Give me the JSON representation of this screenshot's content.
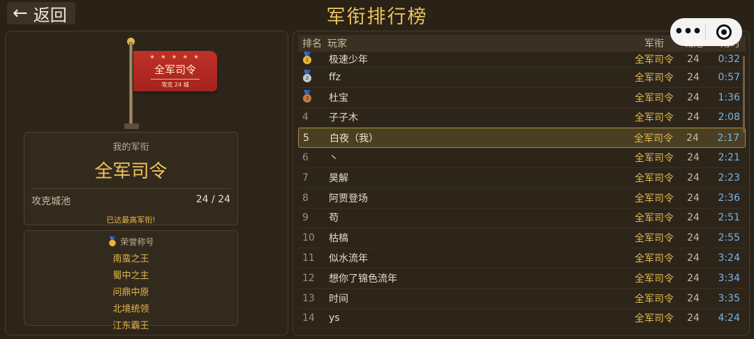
{
  "header": {
    "back_label": "返回",
    "title": "军衔排行榜"
  },
  "flag": {
    "stars": "★ ★ ★ ★ ★",
    "rank": "全军司令",
    "sub": "攻克 24 城"
  },
  "my_rank": {
    "label": "我的军衔",
    "rank": "全军司令",
    "cities_label": "攻克城池",
    "cities_value": "24 / 24",
    "note": "已达最高军衔!"
  },
  "honors": {
    "title": "荣誉称号",
    "items": [
      "南蛮之王",
      "蜀中之主",
      "问鼎中原",
      "北境统领",
      "江东霸王"
    ]
  },
  "table": {
    "headers": {
      "rank": "排名",
      "name": "玩家",
      "title": "军衔",
      "cities": "城池",
      "time": "用时"
    },
    "rows": [
      {
        "rank": "1",
        "name": "极速少年",
        "title": "全军司令",
        "cities": "24",
        "time": "0:32",
        "medal": "gold"
      },
      {
        "rank": "2",
        "name": "ffz",
        "title": "全军司令",
        "cities": "24",
        "time": "0:57",
        "medal": "silver"
      },
      {
        "rank": "3",
        "name": "杜宝",
        "title": "全军司令",
        "cities": "24",
        "time": "1:36",
        "medal": "bronze"
      },
      {
        "rank": "4",
        "name": "子子木",
        "title": "全军司令",
        "cities": "24",
        "time": "2:08"
      },
      {
        "rank": "5",
        "name": "白夜（我）",
        "title": "全军司令",
        "cities": "24",
        "time": "2:17",
        "me": true
      },
      {
        "rank": "6",
        "name": "丶",
        "title": "全军司令",
        "cities": "24",
        "time": "2:21"
      },
      {
        "rank": "7",
        "name": "昊解",
        "title": "全军司令",
        "cities": "24",
        "time": "2:23"
      },
      {
        "rank": "8",
        "name": "阿贾登场",
        "title": "全军司令",
        "cities": "24",
        "time": "2:36"
      },
      {
        "rank": "9",
        "name": "苟",
        "title": "全军司令",
        "cities": "24",
        "time": "2:51"
      },
      {
        "rank": "10",
        "name": "枯槁",
        "title": "全军司令",
        "cities": "24",
        "time": "2:55"
      },
      {
        "rank": "11",
        "name": "似水流年",
        "title": "全军司令",
        "cities": "24",
        "time": "3:24"
      },
      {
        "rank": "12",
        "name": "想你了锦色流年",
        "title": "全军司令",
        "cities": "24",
        "time": "3:34"
      },
      {
        "rank": "13",
        "name": "时间",
        "title": "全军司令",
        "cities": "24",
        "time": "3:35"
      },
      {
        "rank": "14",
        "name": "ys",
        "title": "全军司令",
        "cities": "24",
        "time": "4:24"
      }
    ]
  },
  "colors": {
    "background": "#2a2217",
    "gold_text": "#e3b94f",
    "time_blue": "#79b4e6",
    "flag_red": "#c2302a"
  }
}
